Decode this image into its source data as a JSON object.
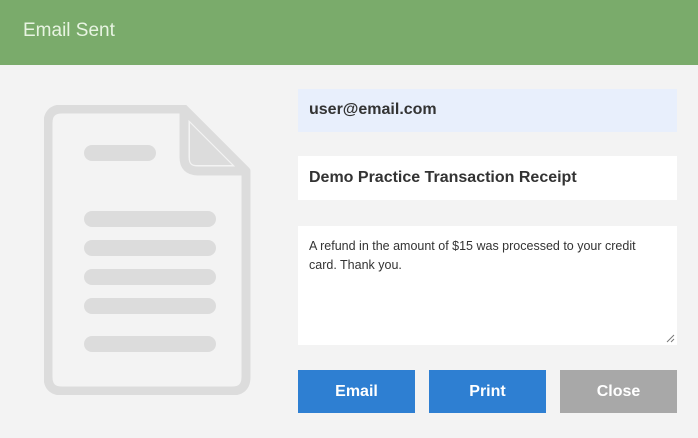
{
  "header": {
    "title": "Email Sent",
    "color": "#7aab6b"
  },
  "form": {
    "email_value": "user@email.com",
    "subject_value": "Demo Practice Transaction Receipt",
    "message_value": "A refund in the amount of $15 was processed to your credit card.  Thank you."
  },
  "buttons": {
    "email_label": "Email",
    "print_label": "Print",
    "close_label": "Close",
    "primary_color": "#2e7fd2",
    "secondary_color": "#a8a8a8"
  },
  "icons": {
    "document": "document-icon"
  }
}
